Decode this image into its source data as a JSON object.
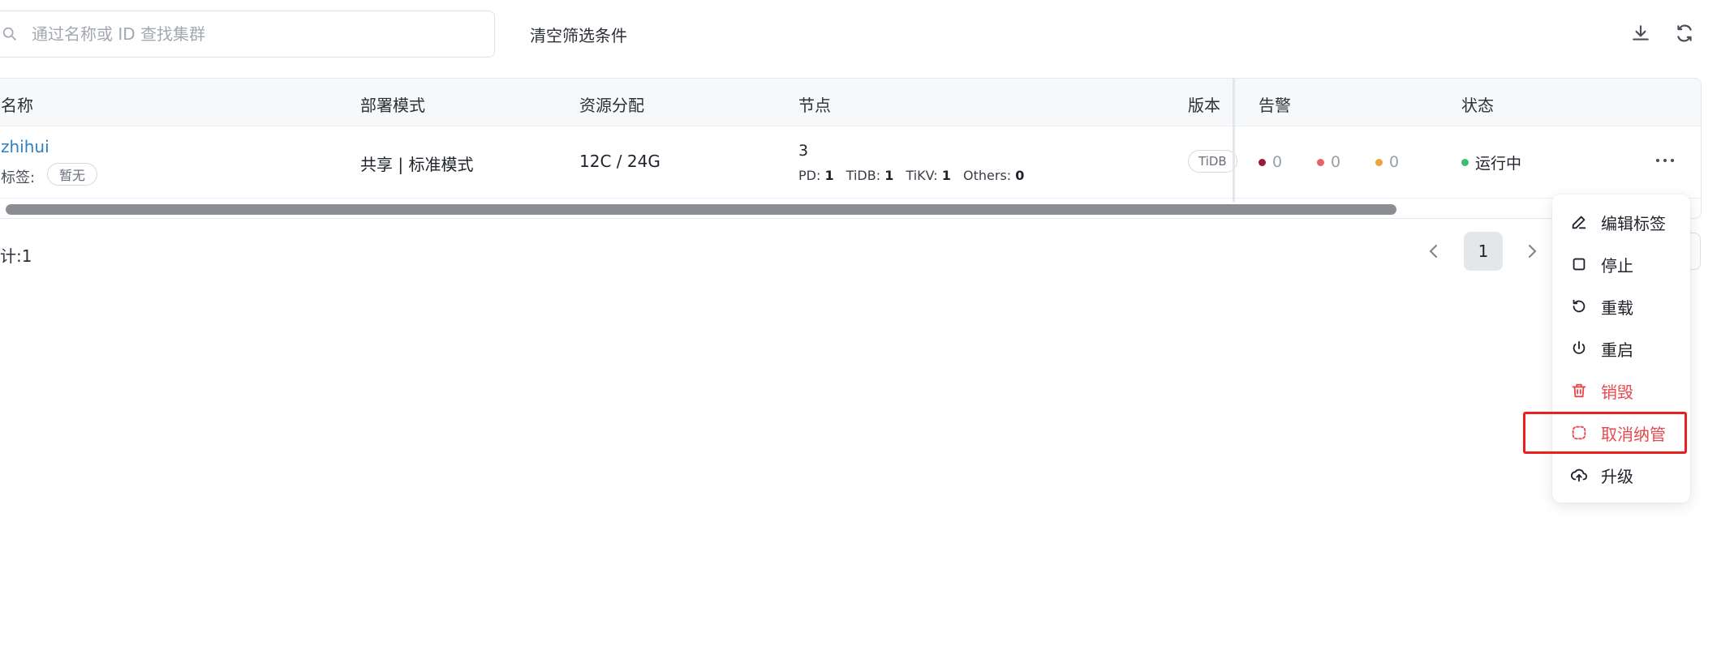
{
  "search": {
    "placeholder": "通过名称或 ID 查找集群",
    "value": ""
  },
  "toolbar": {
    "clear_filters_label": "清空筛选条件"
  },
  "table": {
    "headers": {
      "name": "名称",
      "deploy_mode": "部署模式",
      "resources": "资源分配",
      "nodes": "节点",
      "version": "版本",
      "alerts": "告警",
      "status": "状态"
    },
    "rows": [
      {
        "name": "zhihui",
        "tag_label": "标签:",
        "tag_value": "暂无",
        "deploy_mode": "共享 | 标准模式",
        "resources": "12C / 24G",
        "nodes_total": "3",
        "nodes_pd_label": "PD:",
        "nodes_pd": "1",
        "nodes_tidb_label": "TiDB:",
        "nodes_tidb": "1",
        "nodes_tikv_label": "TiKV:",
        "nodes_tikv": "1",
        "nodes_others_label": "Others:",
        "nodes_others": "0",
        "version": "TiDB",
        "alerts": [
          {
            "level": "critical",
            "count": "0",
            "color": "#9b1b3a"
          },
          {
            "level": "warning",
            "count": "0",
            "color": "#e8626b"
          },
          {
            "level": "info",
            "count": "0",
            "color": "#eba53a"
          }
        ],
        "status": "运行中",
        "status_color": "#3cbf6a"
      }
    ]
  },
  "footer": {
    "total_text": "计:1"
  },
  "pagination": {
    "current_page": "1"
  },
  "action_menu": {
    "items": [
      {
        "label": "编辑标签",
        "icon": "pencil-icon",
        "danger": false
      },
      {
        "label": "停止",
        "icon": "square-icon",
        "danger": false
      },
      {
        "label": "重载",
        "icon": "reload-icon",
        "danger": false
      },
      {
        "label": "重启",
        "icon": "power-icon",
        "danger": false
      },
      {
        "label": "销毁",
        "icon": "trash-icon",
        "danger": true
      },
      {
        "label": "取消纳管",
        "icon": "unlink-icon",
        "danger": true
      },
      {
        "label": "升级",
        "icon": "cloud-upload-icon",
        "danger": false
      }
    ],
    "highlighted_item": "取消纳管"
  },
  "colors": {
    "link": "#2f7fc1",
    "danger": "#e5484d",
    "highlight_border": "#e8211f"
  }
}
